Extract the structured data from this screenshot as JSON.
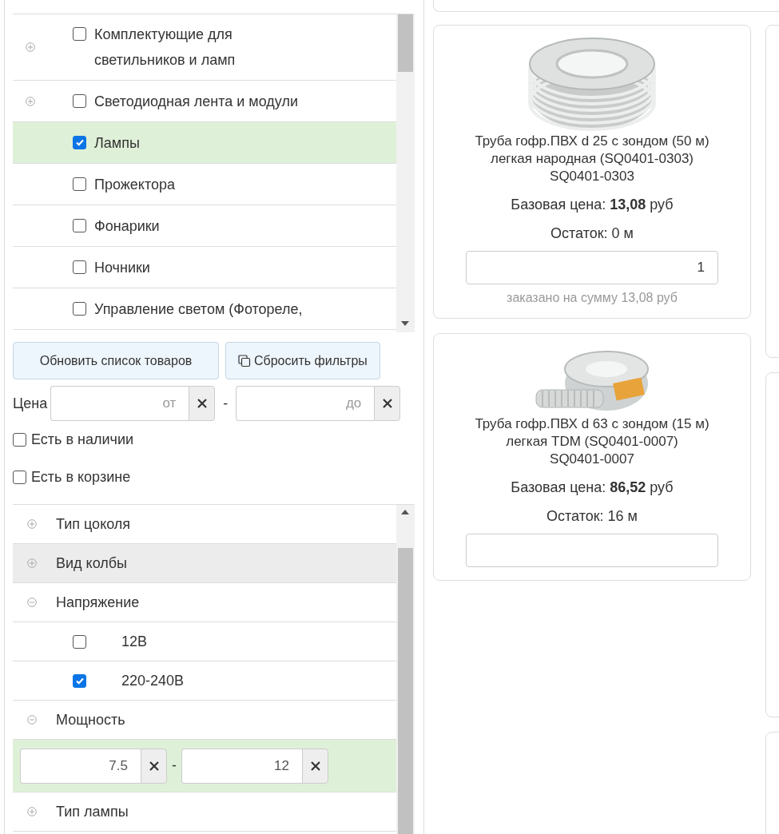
{
  "categories": [
    {
      "label": "Комплектующие для светильников и ламп",
      "checked": false,
      "expandable": true
    },
    {
      "label": "Светодиодная лента и модули",
      "checked": false,
      "expandable": true
    },
    {
      "label": "Лампы",
      "checked": true,
      "expandable": false
    },
    {
      "label": "Прожектора",
      "checked": false,
      "expandable": false
    },
    {
      "label": "Фонарики",
      "checked": false,
      "expandable": false
    },
    {
      "label": "Ночники",
      "checked": false,
      "expandable": false
    },
    {
      "label": "Управление светом (Фотореле,",
      "checked": false,
      "expandable": false
    }
  ],
  "buttons": [
    {
      "label": "Обновить список товаров",
      "icon": false
    },
    {
      "label": "Сбросить фильтры",
      "icon": true
    }
  ],
  "price_filter": {
    "label": "Цена",
    "from_placeholder": "от",
    "separator": "-",
    "to_placeholder": "до"
  },
  "toggles": [
    {
      "label": "Есть в наличии",
      "checked": false
    },
    {
      "label": "Есть в корзине",
      "checked": false
    }
  ],
  "filters": [
    {
      "kind": "group",
      "label": "Тип цоколя",
      "expanded": false,
      "highlighted": false
    },
    {
      "kind": "group",
      "label": "Вид колбы",
      "expanded": false,
      "highlighted": true
    },
    {
      "kind": "group",
      "label": "Напряжение",
      "expanded": true,
      "highlighted": false
    },
    {
      "kind": "option",
      "label": "12В",
      "checked": false
    },
    {
      "kind": "option",
      "label": "220-240В",
      "checked": true
    },
    {
      "kind": "group",
      "label": "Мощность",
      "expanded": true,
      "highlighted": false
    },
    {
      "kind": "range",
      "from": "7.5",
      "separator": "-",
      "to": "12"
    },
    {
      "kind": "group",
      "label": "Тип лампы",
      "expanded": false,
      "highlighted": false
    }
  ],
  "products": [
    {
      "name": "Труба гофр.ПВХ d 25 с зондом (50 м) легкая народная (SQ0401-0303)",
      "sku": "SQ0401-0303",
      "price_label": "Базовая цена:",
      "price": "13,08",
      "currency": "руб",
      "stock": "Остаток: 0 м",
      "quantity": "1",
      "ordered": "заказано на сумму 13,08 руб"
    },
    {
      "name": "Труба гофр.ПВХ d 63 с зондом (15 м) легкая TDM (SQ0401-0007)",
      "sku": "SQ0401-0007",
      "price_label": "Базовая цена:",
      "price": "86,52",
      "currency": "руб",
      "stock": "Остаток: 16 м"
    }
  ]
}
